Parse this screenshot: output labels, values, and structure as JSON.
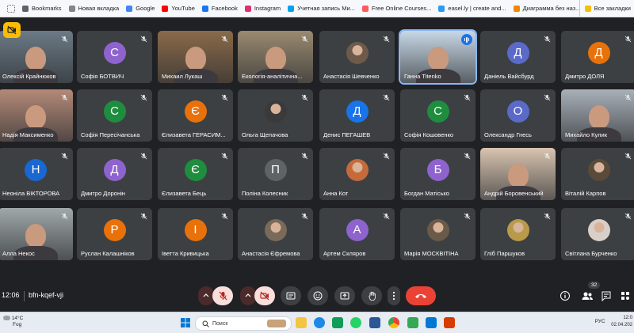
{
  "bookmarks": [
    {
      "label": "",
      "icon": "apps-grid-icon"
    },
    {
      "label": "Bookmarks",
      "icon": "star-icon",
      "color": "#5f6368"
    },
    {
      "label": "Новая вкладка",
      "icon": "tab-icon",
      "color": "#80868b"
    },
    {
      "label": "Google",
      "icon": "google-icon",
      "color": "#4285f4"
    },
    {
      "label": "YouTube",
      "icon": "youtube-icon",
      "color": "#ff0000"
    },
    {
      "label": "Facebook",
      "icon": "facebook-icon",
      "color": "#1877f2"
    },
    {
      "label": "Instagram",
      "icon": "instagram-icon",
      "color": "#e1306c"
    },
    {
      "label": "Учетная запись Ми...",
      "icon": "microsoft-icon",
      "color": "#00a4ef"
    },
    {
      "label": "Free Online Courses...",
      "icon": "course-icon",
      "color": "#ff5a5f"
    },
    {
      "label": "easel.ly | create and...",
      "icon": "easelly-icon",
      "color": "#2b9af3"
    },
    {
      "label": "Диаграмма без наз...",
      "icon": "drawio-icon",
      "color": "#f08705"
    }
  ],
  "all_bookmarks": "Все закладки",
  "meeting": {
    "time": "12:06",
    "code": "bfn-kqef-vji",
    "participants_count": "32"
  },
  "tiles": [
    {
      "name": "Олексій Крайнюков",
      "type": "video",
      "bg": "#6b7a86"
    },
    {
      "name": "Софія БОТВИЧ",
      "type": "avatar",
      "letter": "С",
      "color": "#8e63ce"
    },
    {
      "name": "Михаил Лукаш",
      "type": "video",
      "bg": "#8a6a4a"
    },
    {
      "name": "Екологія-аналітична...",
      "type": "video",
      "bg": "#9a8a70"
    },
    {
      "name": "Анастасія Шевченко",
      "type": "photo",
      "bg": "#6d5a4a"
    },
    {
      "name": "Ганна Titenko",
      "type": "video",
      "bg": "#c8d8e6",
      "speaking": true
    },
    {
      "name": "Даніель Вайсбурд",
      "type": "avatar",
      "letter": "Д",
      "color": "#5b6ac8"
    },
    {
      "name": "Дмитро ДОЛЯ",
      "type": "avatar",
      "letter": "Д",
      "color": "#e8710a"
    },
    {
      "name": "Надія Максименко",
      "type": "video",
      "bg": "#b48a78"
    },
    {
      "name": "Софія Пересічанська",
      "type": "avatar",
      "letter": "С",
      "color": "#1e8e3e"
    },
    {
      "name": "Єлизавета ГЕРАСИМ...",
      "type": "avatar",
      "letter": "Є",
      "color": "#e8710a"
    },
    {
      "name": "Ольга Щепачова",
      "type": "photo",
      "bg": "#3a3a3a"
    },
    {
      "name": "Денис ПЕГАШЕВ",
      "type": "avatar",
      "letter": "Д",
      "color": "#1a73e8"
    },
    {
      "name": "Софія Кошовенко",
      "type": "avatar",
      "letter": "С",
      "color": "#1e8e3e"
    },
    {
      "name": "Олександр Гнесь",
      "type": "avatar",
      "letter": "О",
      "color": "#5b6ac8"
    },
    {
      "name": "Михайло Кулик",
      "type": "video",
      "bg": "#a8b0b8"
    },
    {
      "name": "Неоніла ВІКТОРОВА",
      "type": "avatar",
      "letter": "Н",
      "color": "#1967d2"
    },
    {
      "name": "Дмитро Доронін",
      "type": "avatar",
      "letter": "Д",
      "color": "#8e63ce"
    },
    {
      "name": "Єлизавета Бець",
      "type": "avatar",
      "letter": "Є",
      "color": "#1e8e3e"
    },
    {
      "name": "Поліна Колесник",
      "type": "avatar",
      "letter": "П",
      "color": "#5f6368"
    },
    {
      "name": "Анна Кот",
      "type": "photo",
      "bg": "#c56a3a"
    },
    {
      "name": "Богдан Матісько",
      "type": "avatar",
      "letter": "Б",
      "color": "#8e63ce"
    },
    {
      "name": "Андрій Боровенський",
      "type": "video",
      "bg": "#d8c4b0"
    },
    {
      "name": "Віталій Карпов",
      "type": "photo",
      "bg": "#5a4a3a"
    },
    {
      "name": "Алла Некос",
      "type": "video",
      "bg": "#a0a8a8"
    },
    {
      "name": "Руслан Калашніков",
      "type": "avatar",
      "letter": "Р",
      "color": "#e8710a"
    },
    {
      "name": "Іветта Кривицька",
      "type": "avatar",
      "letter": "І",
      "color": "#e8710a"
    },
    {
      "name": "Анастасія Єфремова",
      "type": "photo",
      "bg": "#7a6a5a"
    },
    {
      "name": "Артем Скляров",
      "type": "avatar",
      "letter": "А",
      "color": "#8e63ce"
    },
    {
      "name": "Марія МОСКВІТІНА",
      "type": "photo",
      "bg": "#6a5a4a"
    },
    {
      "name": "Гліб Паршуков",
      "type": "photo",
      "bg": "#b89a4a"
    },
    {
      "name": "Світлана Бурченко",
      "type": "photo",
      "bg": "#d8d0c8"
    }
  ],
  "controls": {
    "mic": "mic-off-icon",
    "cam": "camera-off-icon",
    "captions": "captions-icon",
    "emoji": "emoji-icon",
    "present": "present-icon",
    "hand": "raise-hand-icon",
    "more": "more-vert-icon",
    "leave": "leave-call-icon"
  },
  "taskbar": {
    "temp": "14°C",
    "weather": "Fog",
    "search_placeholder": "Поиск",
    "lang": "РУС",
    "clock_time": "12:0",
    "clock_date": "02.04.202"
  }
}
